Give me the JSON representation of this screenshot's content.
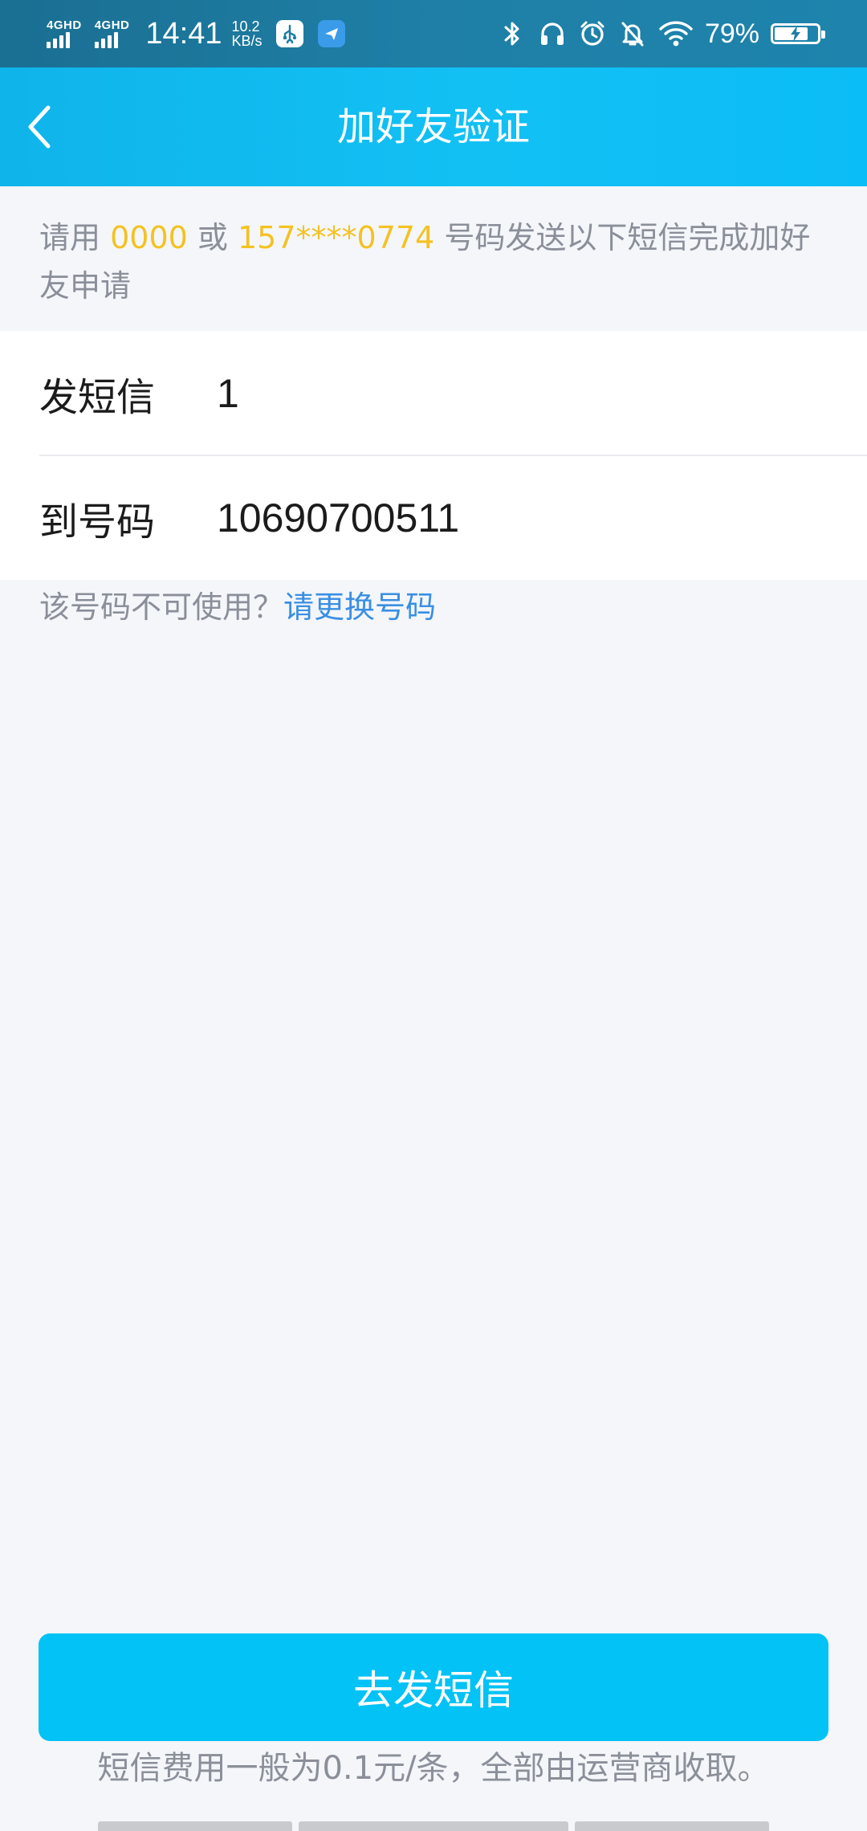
{
  "status_bar": {
    "network_1": "4GHD",
    "network_2": "4GHD",
    "time": "14:41",
    "speed_value": "10.2",
    "speed_unit": "KB/s",
    "battery": "79%",
    "battery_level": 0.79,
    "icons": [
      "usb-app-icon",
      "plane-app-icon",
      "bluetooth-icon",
      "headphones-icon",
      "alarm-icon",
      "mute-icon",
      "wifi-icon",
      "battery-icon"
    ]
  },
  "nav": {
    "title": "加好友验证",
    "back_icon": "chevron-left-icon"
  },
  "notice": {
    "prefix": "请用 ",
    "number_1": "0000",
    "or": " 或 ",
    "number_2": "157****0774",
    "suffix": " 号码发送以下短信完成加好友申请"
  },
  "sms": {
    "content_label": "发短信",
    "content_value": "1",
    "to_label": "到号码",
    "to_value": "10690700511"
  },
  "unavailable": {
    "text": "该号码不可使用？",
    "link": "请更换号码"
  },
  "actions": {
    "send_label": "去发短信",
    "fee_note": "短信费用一般为0.1元/条，全部由运营商收取。"
  },
  "colors": {
    "header": "#0fb4ea",
    "status_bar": "#1a6f92",
    "highlight": "#f4c221",
    "link": "#3a8fe3",
    "button": "#03c2f5",
    "background": "#f4f6fa"
  }
}
